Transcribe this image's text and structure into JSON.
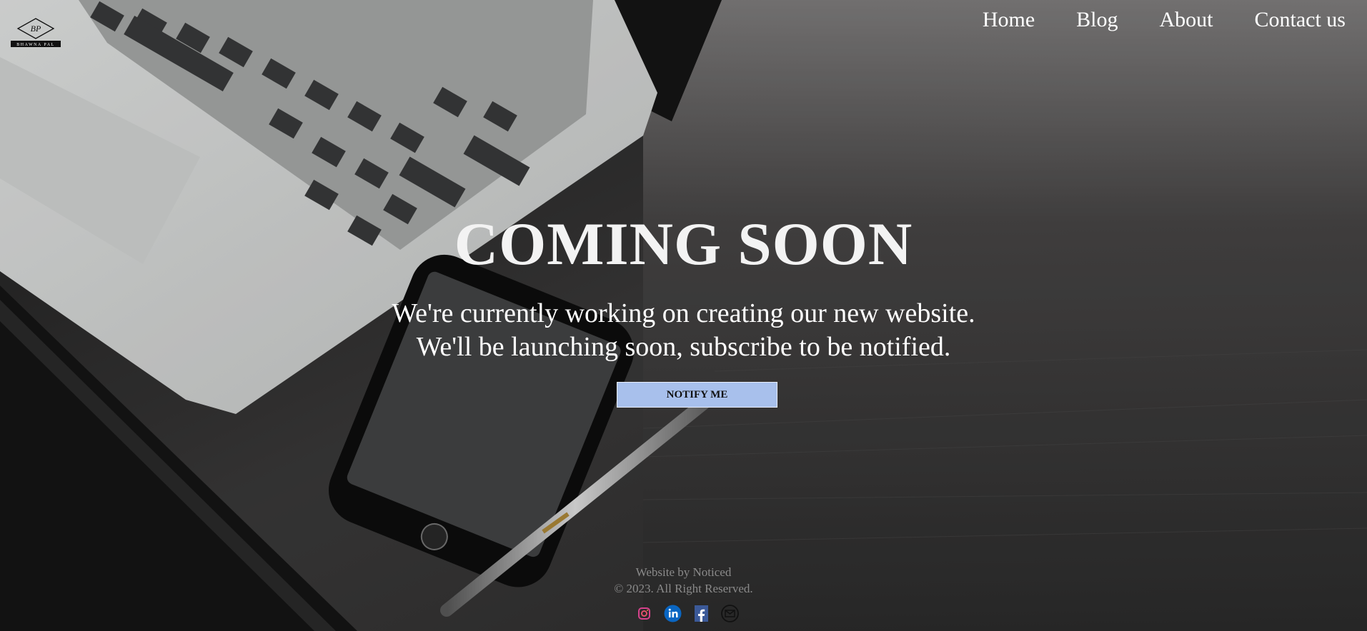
{
  "brand": {
    "logo_initials": "BP",
    "logo_name": "BHAWNA PAL"
  },
  "nav": {
    "items": [
      "Home",
      "Blog",
      "About",
      "Contact us"
    ]
  },
  "hero": {
    "title": "COMING SOON",
    "line1": "We're currently working on creating our new website.",
    "line2": "We'll be launching soon, subscribe to be notified.",
    "button_label": "NOTIFY ME"
  },
  "footer": {
    "credit": "Website by Noticed",
    "copyright": "© 2023. All Right Reserved."
  },
  "social": [
    "instagram-icon",
    "linkedin-icon",
    "facebook-icon",
    "email-icon"
  ],
  "colors": {
    "button_bg": "#a8c0ec",
    "text": "#ffffff",
    "footer_text": "#8a8a8a"
  }
}
